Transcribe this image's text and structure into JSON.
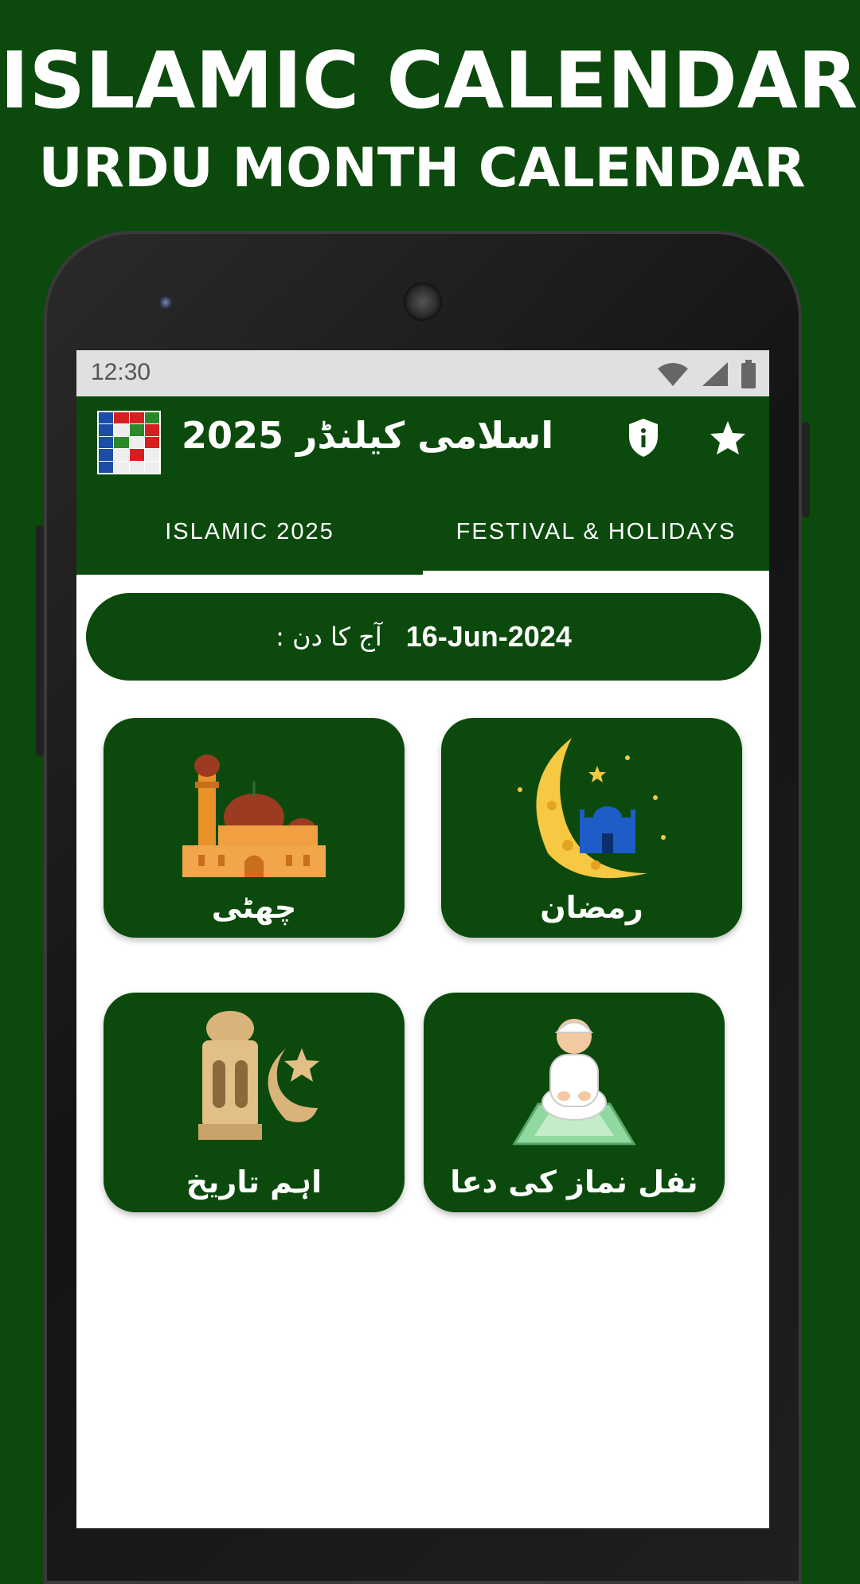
{
  "promo": {
    "title": "ISLAMIC CALENDAR",
    "subtitle": "URDU MONTH CALENDAR"
  },
  "status_bar": {
    "time": "12:30",
    "icons": [
      "wifi-icon",
      "cell-signal-icon",
      "battery-icon"
    ]
  },
  "app_bar": {
    "title": "اسلامی کیلنڈر 2025",
    "icons": [
      "app-logo",
      "privacy-shield-icon",
      "star-icon"
    ]
  },
  "tabs": [
    {
      "label": "ISLAMIC 2025",
      "active": false
    },
    {
      "label": "FESTIVAL & HOLIDAYS",
      "active": true
    }
  ],
  "today": {
    "label": "آج کا دن  :",
    "date": "16-Jun-2024"
  },
  "cards": [
    {
      "label": "چھٹی",
      "icon": "mosque-icon"
    },
    {
      "label": "رمضان",
      "icon": "crescent-moon-mosque-icon"
    },
    {
      "label": "اہم تاریخ",
      "icon": "lantern-crescent-star-icon"
    },
    {
      "label": "نفل نماز کی دعا",
      "icon": "praying-man-icon"
    }
  ],
  "colors": {
    "primary_green": "#0b4a0c",
    "white": "#ffffff",
    "status_bar_gray": "#e0e0e0"
  }
}
